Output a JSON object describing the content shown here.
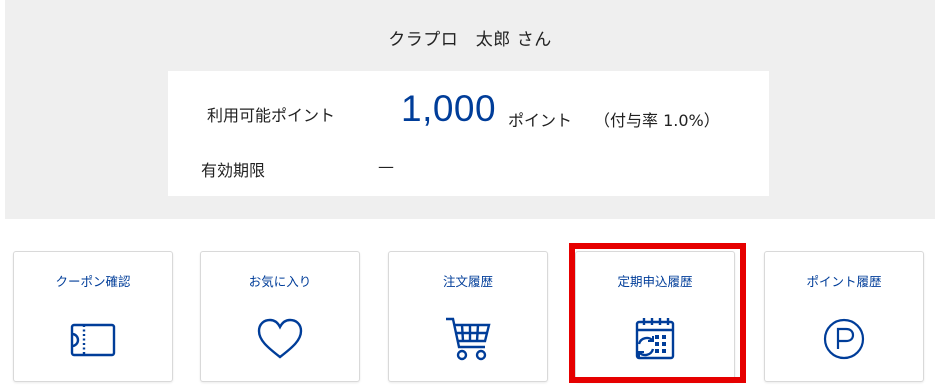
{
  "user": {
    "name": "クラプロ　太郎 さん"
  },
  "points": {
    "label": "利用可能ポイント",
    "value": "1,000",
    "unit": "ポイント",
    "rate": "（付与率 1.0%）",
    "expiry_label": "有効期限",
    "expiry_value": "—"
  },
  "menu": [
    {
      "label": "クーポン確認",
      "icon": "coupon-icon"
    },
    {
      "label": "お気に入り",
      "icon": "heart-icon"
    },
    {
      "label": "注文履歴",
      "icon": "cart-icon"
    },
    {
      "label": "定期申込履歴",
      "icon": "calendar-refresh-icon",
      "highlighted": true
    },
    {
      "label": "ポイント履歴",
      "icon": "point-circle-icon"
    }
  ],
  "colors": {
    "accent": "#003d99",
    "highlight": "#e60000",
    "panel": "#efefef"
  }
}
